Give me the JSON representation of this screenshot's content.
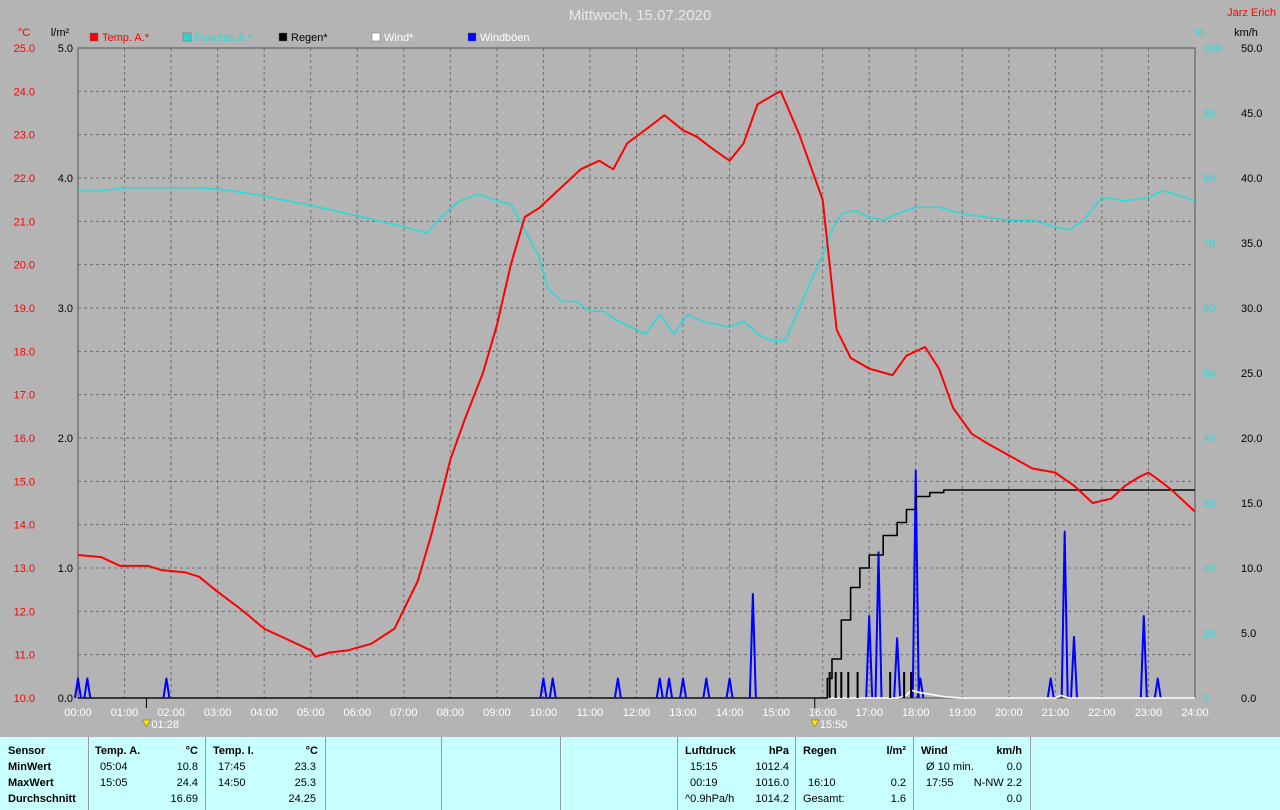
{
  "title": "Mittwoch, 15.07.2020",
  "author": "Jarz Erich",
  "units": {
    "temp": "°C",
    "rain": "l/m²",
    "hum": "%",
    "wind": "km/h"
  },
  "colors": {
    "background": "#b4b4b4",
    "plot": "#b4b4b4",
    "grid": "#6e6e6e",
    "temp": "#ff0000",
    "humidity": "#29d9d9",
    "rain": "#000000",
    "wind": "#ffffff",
    "gusts": "#0000ff",
    "stats_bg": "#c8ffff"
  },
  "chart_data": {
    "type": "line",
    "title": "Mittwoch, 15.07.2020",
    "legend_placement": "top-left",
    "grid": true,
    "x_ticks": [
      "00:00",
      "01:00",
      "02:00",
      "03:00",
      "04:00",
      "05:00",
      "06:00",
      "07:00",
      "08:00",
      "09:00",
      "10:00",
      "11:00",
      "12:00",
      "13:00",
      "14:00",
      "15:00",
      "16:00",
      "17:00",
      "18:00",
      "19:00",
      "20:00",
      "21:00",
      "22:00",
      "23:00",
      "24:00"
    ],
    "xlim": [
      0,
      24
    ],
    "axes": {
      "temp": {
        "label": "°C",
        "range": [
          10,
          25
        ],
        "ticks": [
          "25.0",
          "24.0",
          "23.0",
          "22.0",
          "21.0",
          "20.0",
          "19.0",
          "18.0",
          "17.0",
          "16.0",
          "15.0",
          "14.0",
          "13.0",
          "12.0",
          "11.0",
          "10.0"
        ]
      },
      "rain": {
        "label": "l/m²",
        "range": [
          0,
          5
        ],
        "ticks": [
          "5.0",
          "4.0",
          "3.0",
          "2.0",
          "1.0",
          "0.0"
        ]
      },
      "hum": {
        "label": "%",
        "range": [
          0,
          100
        ],
        "ticks": [
          "100",
          "90",
          "80",
          "70",
          "60",
          "50",
          "40",
          "30",
          "20",
          "10",
          "0"
        ]
      },
      "wind": {
        "label": "km/h",
        "range": [
          0,
          50
        ],
        "ticks": [
          "50.0",
          "45.0",
          "40.0",
          "35.0",
          "30.0",
          "25.0",
          "20.0",
          "15.0",
          "10.0",
          "5.0",
          "0.0"
        ]
      }
    },
    "markers": [
      {
        "x": 1.47,
        "label": "01:28"
      },
      {
        "x": 15.83,
        "label": "15:50"
      }
    ],
    "series": [
      {
        "name": "Temp. A.*",
        "axis": "temp",
        "color": "#ff0000",
        "kind": "line",
        "x": [
          0,
          0.5,
          0.9,
          1.5,
          1.8,
          2.3,
          2.6,
          3.0,
          3.5,
          4.0,
          4.5,
          5.0,
          5.1,
          5.4,
          5.8,
          6.3,
          6.8,
          7.3,
          7.6,
          8.0,
          8.3,
          8.7,
          9.0,
          9.3,
          9.6,
          9.9,
          10.2,
          10.5,
          10.8,
          11.2,
          11.5,
          11.8,
          12.3,
          12.6,
          13.0,
          13.3,
          13.6,
          14.0,
          14.3,
          14.6,
          15.0,
          15.1,
          15.5,
          16.0,
          16.3,
          16.6,
          17.0,
          17.5,
          17.8,
          18.2,
          18.5,
          18.8,
          19.2,
          19.5,
          20.0,
          20.5,
          21.0,
          21.4,
          21.8,
          22.2,
          22.5,
          22.8,
          23.0,
          23.2,
          23.5,
          23.8,
          24.0
        ],
        "y": [
          13.3,
          13.25,
          13.05,
          13.05,
          12.95,
          12.9,
          12.8,
          12.45,
          12.05,
          11.6,
          11.35,
          11.1,
          10.95,
          11.05,
          11.1,
          11.25,
          11.6,
          12.7,
          13.8,
          15.5,
          16.4,
          17.5,
          18.6,
          20.0,
          21.1,
          21.3,
          21.6,
          21.9,
          22.2,
          22.4,
          22.2,
          22.8,
          23.2,
          23.45,
          23.1,
          22.95,
          22.7,
          22.4,
          22.8,
          23.7,
          23.95,
          24.0,
          23.0,
          21.5,
          18.5,
          17.85,
          17.6,
          17.45,
          17.9,
          18.1,
          17.6,
          16.7,
          16.1,
          15.9,
          15.6,
          15.3,
          15.2,
          14.9,
          14.5,
          14.6,
          14.9,
          15.1,
          15.2,
          15.05,
          14.8,
          14.5,
          14.3
        ]
      },
      {
        "name": "Feuchte A.*",
        "axis": "hum",
        "color": "#29d9d9",
        "kind": "line",
        "x": [
          0,
          0.5,
          1.0,
          1.5,
          2.0,
          2.5,
          3.0,
          3.5,
          4.0,
          4.5,
          5.0,
          5.5,
          6.0,
          6.5,
          7.0,
          7.5,
          7.8,
          8.2,
          8.6,
          9.0,
          9.3,
          9.6,
          9.9,
          10.1,
          10.4,
          10.7,
          11.0,
          11.3,
          11.6,
          11.9,
          12.2,
          12.5,
          12.8,
          13.1,
          13.4,
          13.7,
          14.0,
          14.3,
          14.6,
          14.9,
          15.2,
          15.5,
          15.8,
          16.0,
          16.2,
          16.4,
          16.7,
          17.0,
          17.3,
          17.6,
          18.0,
          18.5,
          19.0,
          19.5,
          20.0,
          20.5,
          21.0,
          21.3,
          21.6,
          22.0,
          22.5,
          23.0,
          23.3,
          23.6,
          24.0
        ],
        "y": [
          78,
          78,
          78.5,
          78.5,
          78.5,
          78.5,
          78.3,
          77.8,
          77.2,
          76.5,
          75.8,
          75.0,
          74.2,
          73.3,
          72.5,
          71.5,
          74,
          76.5,
          77.5,
          76.5,
          76,
          72,
          68,
          63,
          61,
          61,
          59.5,
          59.5,
          58,
          57,
          56,
          59,
          56,
          59,
          58,
          57.5,
          57,
          58,
          56,
          55,
          55,
          60,
          65,
          68,
          72,
          74.5,
          75,
          74,
          73.5,
          74.5,
          75.5,
          75.5,
          74.5,
          74,
          73.5,
          73.5,
          72.5,
          72,
          73.5,
          77,
          76.5,
          77,
          78,
          77.5,
          76.5
        ]
      },
      {
        "name": "Regen*",
        "axis": "rain",
        "color": "#000000",
        "kind": "step",
        "x": [
          0,
          16.0,
          16.1,
          16.2,
          16.4,
          16.6,
          16.8,
          17.0,
          17.3,
          17.6,
          17.8,
          18.0,
          18.3,
          18.6,
          19.0,
          20.0,
          24.0
        ],
        "y": [
          0,
          0,
          0.15,
          0.3,
          0.6,
          0.85,
          1.0,
          1.1,
          1.25,
          1.35,
          1.45,
          1.55,
          1.58,
          1.6,
          1.6,
          1.6,
          1.6
        ]
      },
      {
        "name": "Wind*",
        "axis": "wind",
        "color": "#ffffff",
        "kind": "line",
        "x": [
          0,
          17.6,
          17.8,
          17.9,
          18.1,
          18.3,
          18.6,
          19.0,
          21.0,
          21.1,
          21.2,
          21.3,
          24.0
        ],
        "y": [
          0,
          0,
          0.2,
          0.6,
          0.4,
          0.3,
          0.1,
          0,
          0,
          0.2,
          0.1,
          0,
          0
        ]
      },
      {
        "name": "Windböen",
        "axis": "wind",
        "color": "#0000ff",
        "kind": "spikes",
        "x": [
          0,
          0.2,
          1.9,
          10.0,
          10.2,
          11.6,
          12.5,
          12.7,
          13.0,
          13.5,
          14.0,
          14.5,
          17.0,
          17.2,
          17.6,
          18.0,
          18.1,
          20.9,
          21.2,
          21.4,
          22.9,
          23.2
        ],
        "y": [
          1.5,
          1.5,
          1.5,
          1.5,
          1.5,
          1.5,
          1.5,
          1.5,
          1.5,
          1.5,
          1.5,
          8.0,
          6.3,
          11.2,
          4.6,
          17.5,
          1.5,
          1.5,
          12.8,
          4.7,
          6.3,
          1.5
        ]
      }
    ]
  },
  "stats": {
    "headers": {
      "sensor": "Sensor",
      "temp_a": "Temp. A.",
      "temp_i": "Temp. I.",
      "pressure": "Luftdruck",
      "rain": "Regen",
      "wind": "Wind"
    },
    "units": {
      "temp_a": "°C",
      "temp_i": "°C",
      "pressure": "hPa",
      "rain": "l/m²",
      "wind": "km/h"
    },
    "rows": [
      "MinWert",
      "MaxWert",
      "Durchschnitt"
    ],
    "temp_a": [
      [
        "05:04",
        "10.8"
      ],
      [
        "15:05",
        "24.4"
      ],
      [
        "",
        "16.69"
      ]
    ],
    "temp_i": [
      [
        "17:45",
        "23.3"
      ],
      [
        "14:50",
        "25.3"
      ],
      [
        "",
        "24.25"
      ]
    ],
    "pressure": [
      [
        "15:15",
        "1012.4"
      ],
      [
        "00:19",
        "1016.0"
      ],
      [
        "^0.9hPa/h",
        "1014.2"
      ]
    ],
    "rain": [
      [
        "",
        ""
      ],
      [
        "16:10",
        "0.2"
      ],
      [
        "Gesamt:",
        "1.6"
      ]
    ],
    "wind": [
      [
        "Ø 10 min.",
        "0.0"
      ],
      [
        "17:55",
        "N-NW 2.2"
      ],
      [
        "",
        "0.0"
      ]
    ]
  }
}
